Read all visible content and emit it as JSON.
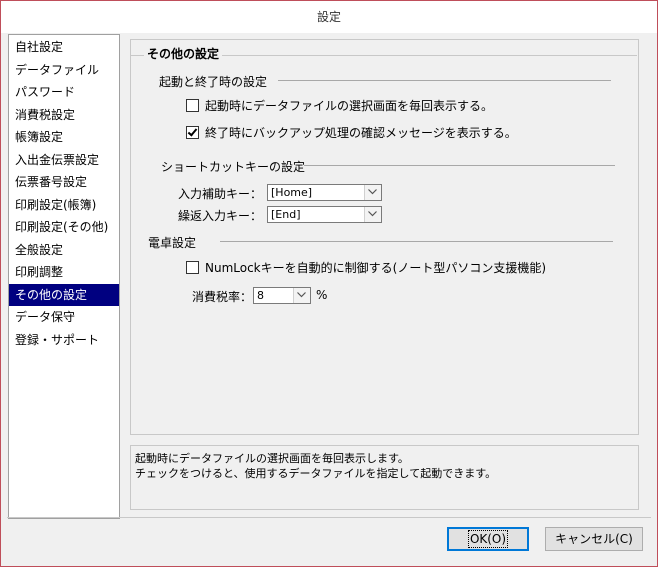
{
  "window": {
    "title": "設定"
  },
  "nav": {
    "items": [
      {
        "label": "自社設定",
        "selected": false
      },
      {
        "label": "データファイル",
        "selected": false
      },
      {
        "label": "パスワード",
        "selected": false
      },
      {
        "label": "消費税設定",
        "selected": false
      },
      {
        "label": "帳簿設定",
        "selected": false
      },
      {
        "label": "入出金伝票設定",
        "selected": false
      },
      {
        "label": "伝票番号設定",
        "selected": false
      },
      {
        "label": "印刷設定(帳簿)",
        "selected": false
      },
      {
        "label": "印刷設定(その他)",
        "selected": false
      },
      {
        "label": "全般設定",
        "selected": false
      },
      {
        "label": "印刷調整",
        "selected": false
      },
      {
        "label": "その他の設定",
        "selected": true
      },
      {
        "label": "データ保守",
        "selected": false
      },
      {
        "label": "登録・サポート",
        "selected": false
      }
    ]
  },
  "panel": {
    "title": "その他の設定",
    "startup_section": {
      "label": "起動と終了時の設定",
      "show_file_dialog": {
        "label": "起動時にデータファイルの選択画面を毎回表示する。",
        "checked": false
      },
      "backup_confirm": {
        "label": "終了時にバックアップ処理の確認メッセージを表示する。",
        "checked": true
      }
    },
    "shortcut_section": {
      "label": "ショートカットキーの設定",
      "input_assist": {
        "label": "入力補助キー：",
        "value": "[Home]"
      },
      "repeat_input": {
        "label": "繰返入力キー：",
        "value": "[End]"
      }
    },
    "calculator_section": {
      "label": "電卓設定",
      "numlock": {
        "label": "NumLockキーを自動的に制御する(ノート型パソコン支援機能)",
        "checked": false
      },
      "tax_rate": {
        "label": "消費税率：",
        "value": "8",
        "unit": "%"
      }
    }
  },
  "description": {
    "line1": "起動時にデータファイルの選択画面を毎回表示します。",
    "line2": "チェックをつけると、使用するデータファイルを指定して起動できます。"
  },
  "buttons": {
    "ok": "OK(O)",
    "cancel": "キャンセル(C)"
  },
  "colors": {
    "selection": "#000080",
    "window_border": "#bf4e5a",
    "default_button": "#0078d7"
  }
}
